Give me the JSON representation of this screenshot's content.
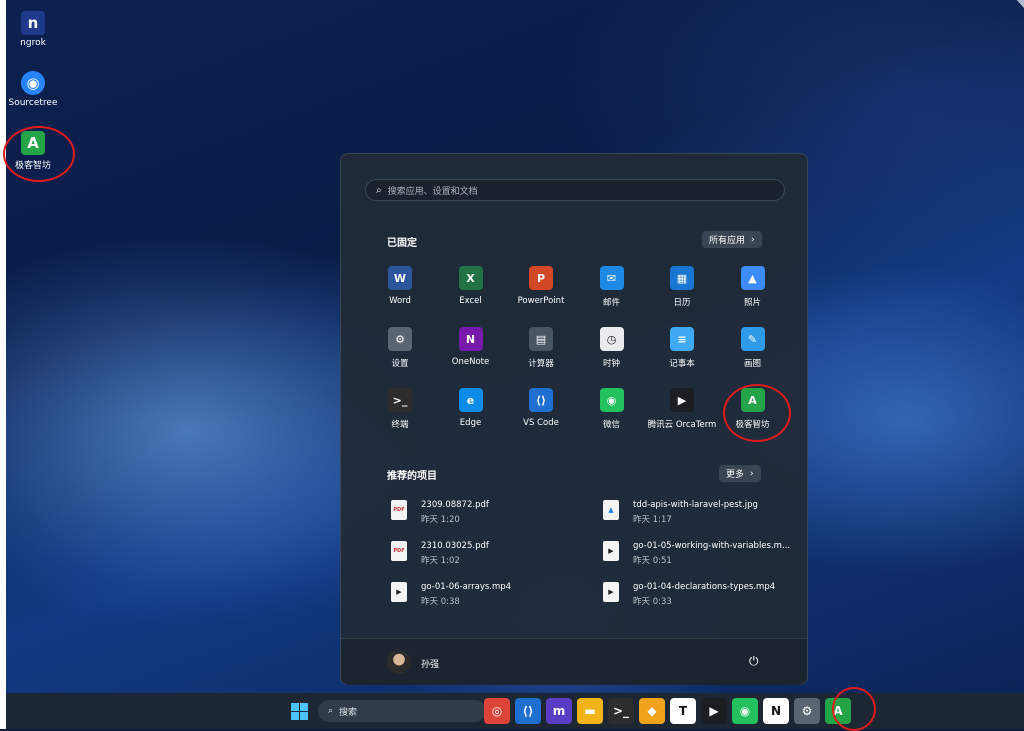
{
  "desktop": {
    "icons": [
      {
        "label": "ngrok",
        "icon": "ngrok-icon",
        "glyph": "n",
        "color": "#1f3a8a"
      },
      {
        "label": "Sourcetree",
        "icon": "sourcetree-icon",
        "glyph": "◉",
        "color": "#2684ff"
      },
      {
        "label": "极客智坊",
        "icon": "geek-smart-icon",
        "glyph": "A",
        "color": "#22a447"
      }
    ]
  },
  "start_menu": {
    "search_placeholder": "搜索应用、设置和文档",
    "pinned_title": "已固定",
    "all_apps_label": "所有应用",
    "pinned": [
      {
        "label": "Word",
        "icon": "word-icon",
        "glyph": "W",
        "color": "#2b579a"
      },
      {
        "label": "Excel",
        "icon": "excel-icon",
        "glyph": "X",
        "color": "#217346"
      },
      {
        "label": "PowerPoint",
        "icon": "powerpoint-icon",
        "glyph": "P",
        "color": "#d24726"
      },
      {
        "label": "邮件",
        "icon": "mail-icon",
        "glyph": "✉",
        "color": "#1e88e5"
      },
      {
        "label": "日历",
        "icon": "calendar-icon",
        "glyph": "▦",
        "color": "#1976d2"
      },
      {
        "label": "照片",
        "icon": "photos-icon",
        "glyph": "▲",
        "color": "#3d8bfd"
      },
      {
        "label": "设置",
        "icon": "settings-icon",
        "glyph": "⚙",
        "color": "#5b6472"
      },
      {
        "label": "OneNote",
        "icon": "onenote-icon",
        "glyph": "N",
        "color": "#7719aa"
      },
      {
        "label": "计算器",
        "icon": "calculator-icon",
        "glyph": "▤",
        "color": "#4a5563"
      },
      {
        "label": "时钟",
        "icon": "clock-icon",
        "glyph": "◷",
        "color": "#e9ecef"
      },
      {
        "label": "记事本",
        "icon": "notepad-icon",
        "glyph": "≡",
        "color": "#3fa9f5"
      },
      {
        "label": "画图",
        "icon": "paint-icon",
        "glyph": "✎",
        "color": "#2f9be8"
      },
      {
        "label": "终端",
        "icon": "terminal-icon",
        "glyph": ">_",
        "color": "#2d2d2d"
      },
      {
        "label": "Edge",
        "icon": "edge-icon",
        "glyph": "e",
        "color": "#0c8ce9"
      },
      {
        "label": "VS Code",
        "icon": "vscode-icon",
        "glyph": "⟨⟩",
        "color": "#1f6fd0"
      },
      {
        "label": "微信",
        "icon": "wechat-icon",
        "glyph": "◉",
        "color": "#22c15e"
      },
      {
        "label": "腾讯云 OrcaTerm",
        "icon": "orcaterm-icon",
        "glyph": "▶",
        "color": "#1b1f24"
      },
      {
        "label": "极客智坊",
        "icon": "geek-smart-icon",
        "glyph": "A",
        "color": "#22a447"
      }
    ],
    "recommended_title": "推荐的项目",
    "more_label": "更多",
    "recommended": [
      {
        "name": "2309.08872.pdf",
        "time": "昨天 1:20",
        "icon": "pdf-file-icon",
        "glyph": "PDF"
      },
      {
        "name": "tdd-apis-with-laravel-pest.jpg",
        "time": "昨天 1:17",
        "icon": "image-file-icon",
        "glyph": "▲"
      },
      {
        "name": "2310.03025.pdf",
        "time": "昨天 1:02",
        "icon": "pdf-file-icon",
        "glyph": "PDF"
      },
      {
        "name": "go-01-05-working-with-variables.m...",
        "time": "昨天 0:51",
        "icon": "video-file-icon",
        "glyph": "▶"
      },
      {
        "name": "go-01-06-arrays.mp4",
        "time": "昨天 0:38",
        "icon": "video-file-icon",
        "glyph": "▶"
      },
      {
        "name": "go-01-04-declarations-types.mp4",
        "time": "昨天 0:33",
        "icon": "video-file-icon",
        "glyph": "▶"
      }
    ],
    "user_name": "孙强"
  },
  "taskbar": {
    "search_label": "搜索",
    "apps": [
      {
        "icon": "chrome-icon",
        "glyph": "◎",
        "color": "#db4437"
      },
      {
        "icon": "vscode-icon",
        "glyph": "⟨⟩",
        "color": "#1f6fd0"
      },
      {
        "icon": "ml-app-icon",
        "glyph": "m",
        "color": "#5b3cc4"
      },
      {
        "icon": "file-explorer-icon",
        "glyph": "▬",
        "color": "#f2b418"
      },
      {
        "icon": "terminal-icon",
        "glyph": ">_",
        "color": "#2d2d2d"
      },
      {
        "icon": "tableplus-icon",
        "glyph": "◆",
        "color": "#f0a21a"
      },
      {
        "icon": "typora-icon",
        "glyph": "T",
        "color": "#ffffff"
      },
      {
        "icon": "orcaterm-icon",
        "glyph": "▶",
        "color": "#1b1f24"
      },
      {
        "icon": "wechat-icon",
        "glyph": "◉",
        "color": "#22c15e"
      },
      {
        "icon": "notion-icon",
        "glyph": "N",
        "color": "#ffffff"
      },
      {
        "icon": "settings-icon",
        "glyph": "⚙",
        "color": "#5b6472"
      },
      {
        "icon": "geek-smart-icon",
        "glyph": "A",
        "color": "#22a447"
      }
    ]
  }
}
